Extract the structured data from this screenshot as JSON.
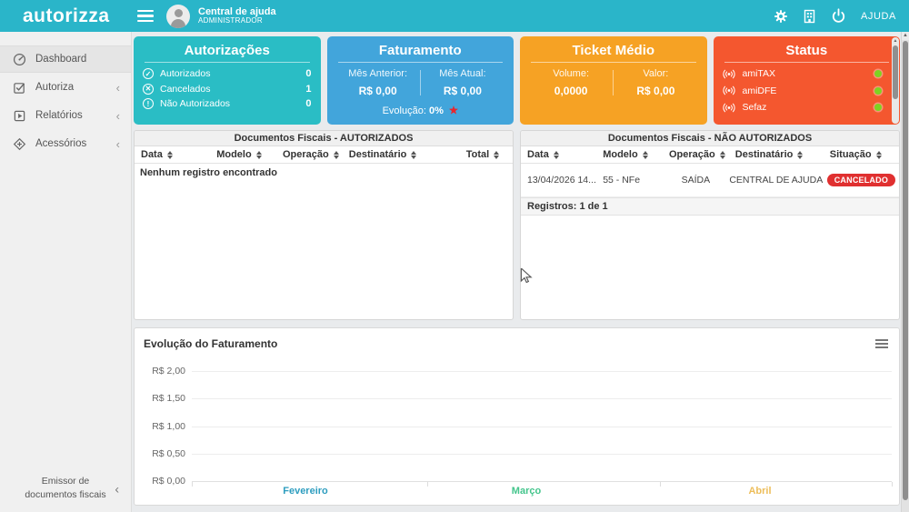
{
  "header": {
    "logo": "autorizza",
    "user_name": "Central de ajuda",
    "user_role": "ADMINISTRADOR",
    "help_label": "AJUDA",
    "bar_color": "#2ab5c9"
  },
  "sidebar": {
    "items": [
      {
        "label": "Dashboard",
        "icon": "dashboard-icon",
        "expandable": false,
        "active": true
      },
      {
        "label": "Autoriza",
        "icon": "authorize-icon",
        "expandable": true,
        "active": false
      },
      {
        "label": "Relatórios",
        "icon": "reports-icon",
        "expandable": true,
        "active": false
      },
      {
        "label": "Acessórios",
        "icon": "accessories-icon",
        "expandable": true,
        "active": false
      }
    ],
    "collapse_chevron": "‹",
    "footer": {
      "line1": "Emissor de",
      "line2": "documentos fiscais"
    }
  },
  "cards": {
    "autorizacoes": {
      "title": "Autorizações",
      "color": "#2abdc5",
      "rows": [
        {
          "icon": "check-circle-icon",
          "glyph": "✓",
          "label": "Autorizados",
          "value": "0"
        },
        {
          "icon": "x-circle-icon",
          "glyph": "✕",
          "label": "Cancelados",
          "value": "1"
        },
        {
          "icon": "exclamation-circle-icon",
          "glyph": "!",
          "label": "Não Autorizados",
          "value": "0"
        }
      ]
    },
    "faturamento": {
      "title": "Faturamento",
      "color": "#42a5db",
      "left_label": "Mês Anterior:",
      "left_value": "R$ 0,00",
      "right_label": "Mês Atual:",
      "right_value": "R$ 0,00",
      "footer_label": "Evolução:",
      "footer_value": "0%",
      "footer_icon_color": "#e8262d"
    },
    "ticket_medio": {
      "title": "Ticket Médio",
      "color": "#f6a224",
      "left_label": "Volume:",
      "left_value": "0,0000",
      "right_label": "Valor:",
      "right_value": "R$ 0,00"
    },
    "status": {
      "title": "Status",
      "color": "#f4572f",
      "rows": [
        {
          "icon": "broadcast-icon",
          "label": "amiTAX",
          "status_color": "#7ed321"
        },
        {
          "icon": "broadcast-icon",
          "label": "amiDFE",
          "status_color": "#7ed321"
        },
        {
          "icon": "broadcast-icon",
          "label": "Sefaz",
          "status_color": "#7ed321"
        }
      ]
    }
  },
  "tables": {
    "authorized": {
      "title": "Documentos Fiscais - AUTORIZADOS",
      "columns": [
        "Data",
        "Modelo",
        "Operação",
        "Destinatário",
        "Total"
      ],
      "empty_message": "Nenhum registro encontrado"
    },
    "not_authorized": {
      "title": "Documentos Fiscais - NÃO AUTORIZADOS",
      "columns": [
        "Data",
        "Modelo",
        "Operação",
        "Destinatário",
        "Situação"
      ],
      "rows": [
        {
          "data": "13/04/2026 14...",
          "modelo": "55 - NFe",
          "operacao": "SAÍDA",
          "destinatario": "CENTRAL DE AJUDA",
          "situacao": "CANCELADO",
          "situacao_color": "#e03030"
        }
      ],
      "footer": "Registros: 1 de 1"
    }
  },
  "chart": {
    "title": "Evolução do Faturamento",
    "ylabels_desc": [
      "R$ 2,00",
      "R$ 1,50",
      "R$ 1,00",
      "R$ 0,50",
      "R$ 0,00"
    ],
    "legend": [
      {
        "label": "Fevereiro",
        "color": "#2d9dbf"
      },
      {
        "label": "Março",
        "color": "#44c58c"
      },
      {
        "label": "Abril",
        "color": "#edbd59"
      }
    ]
  },
  "chart_data": {
    "type": "line",
    "title": "Evolução do Faturamento",
    "categories": [],
    "series": [
      {
        "name": "Fevereiro",
        "color": "#2d9dbf",
        "values": []
      },
      {
        "name": "Março",
        "color": "#44c58c",
        "values": []
      },
      {
        "name": "Abril",
        "color": "#edbd59",
        "values": []
      }
    ],
    "ylabel_ticks": [
      "R$ 0,00",
      "R$ 0,50",
      "R$ 1,00",
      "R$ 1,50",
      "R$ 2,00"
    ],
    "ylim": [
      0,
      2
    ],
    "grid": true,
    "legend_position": "bottom",
    "notes": "no data plotted; empty series"
  }
}
